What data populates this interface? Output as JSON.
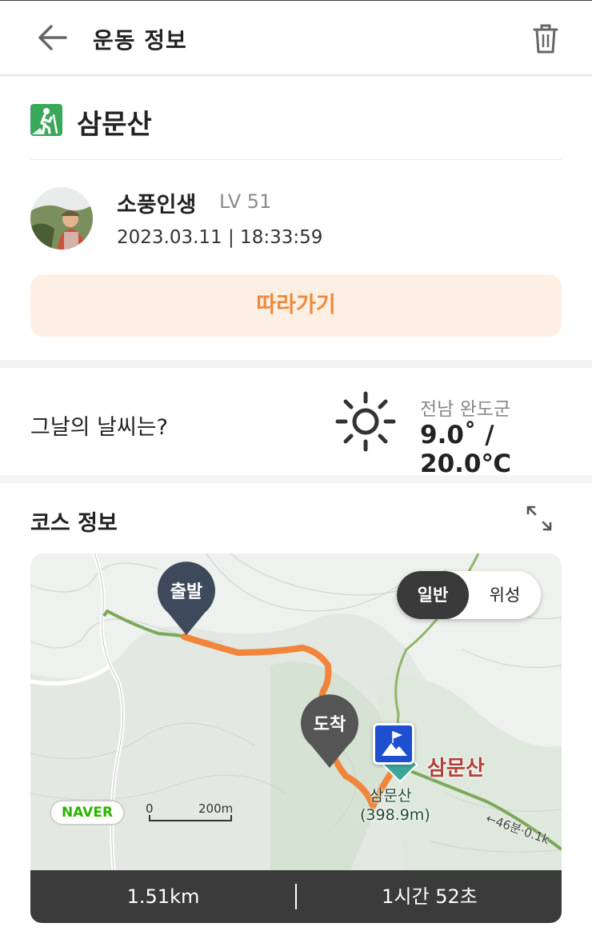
{
  "header": {
    "title": "운동 정보",
    "back_icon": "arrow-left-icon",
    "delete_icon": "trash-icon"
  },
  "course": {
    "icon": "hiking-icon",
    "title": "삼문산"
  },
  "user": {
    "name": "소풍인생",
    "level": "LV 51",
    "date": "2023.03.11 | 18:33:59"
  },
  "follow": {
    "label": "따라가기"
  },
  "weather": {
    "question": "그날의 날씨는?",
    "icon": "sun-icon",
    "region": "전남 완도군",
    "temperature": "9.0˚ / 20.0℃"
  },
  "course_info": {
    "title": "코스 정보",
    "expand_icon": "expand-icon"
  },
  "map": {
    "toggle": {
      "normal": "일반",
      "satellite": "위성",
      "selected": "일반"
    },
    "start_label": "출발",
    "end_label": "도착",
    "peak_name": "삼문산",
    "peak_name_small": "삼문산",
    "peak_elevation": "(398.9m)",
    "trail_label": "←46분·0.1k",
    "logo": "NAVER",
    "scale_start": "0",
    "scale_distance": "200m",
    "route_color": "#f0853b",
    "trail_color": "#7da85a"
  },
  "stats": {
    "distance": "1.51km",
    "duration": "1시간 52초"
  },
  "colors": {
    "accent": "#ee8a3d",
    "accent_bg": "#fdefe4",
    "dark": "#3b3b3b",
    "hike_green": "#3aa85a"
  }
}
